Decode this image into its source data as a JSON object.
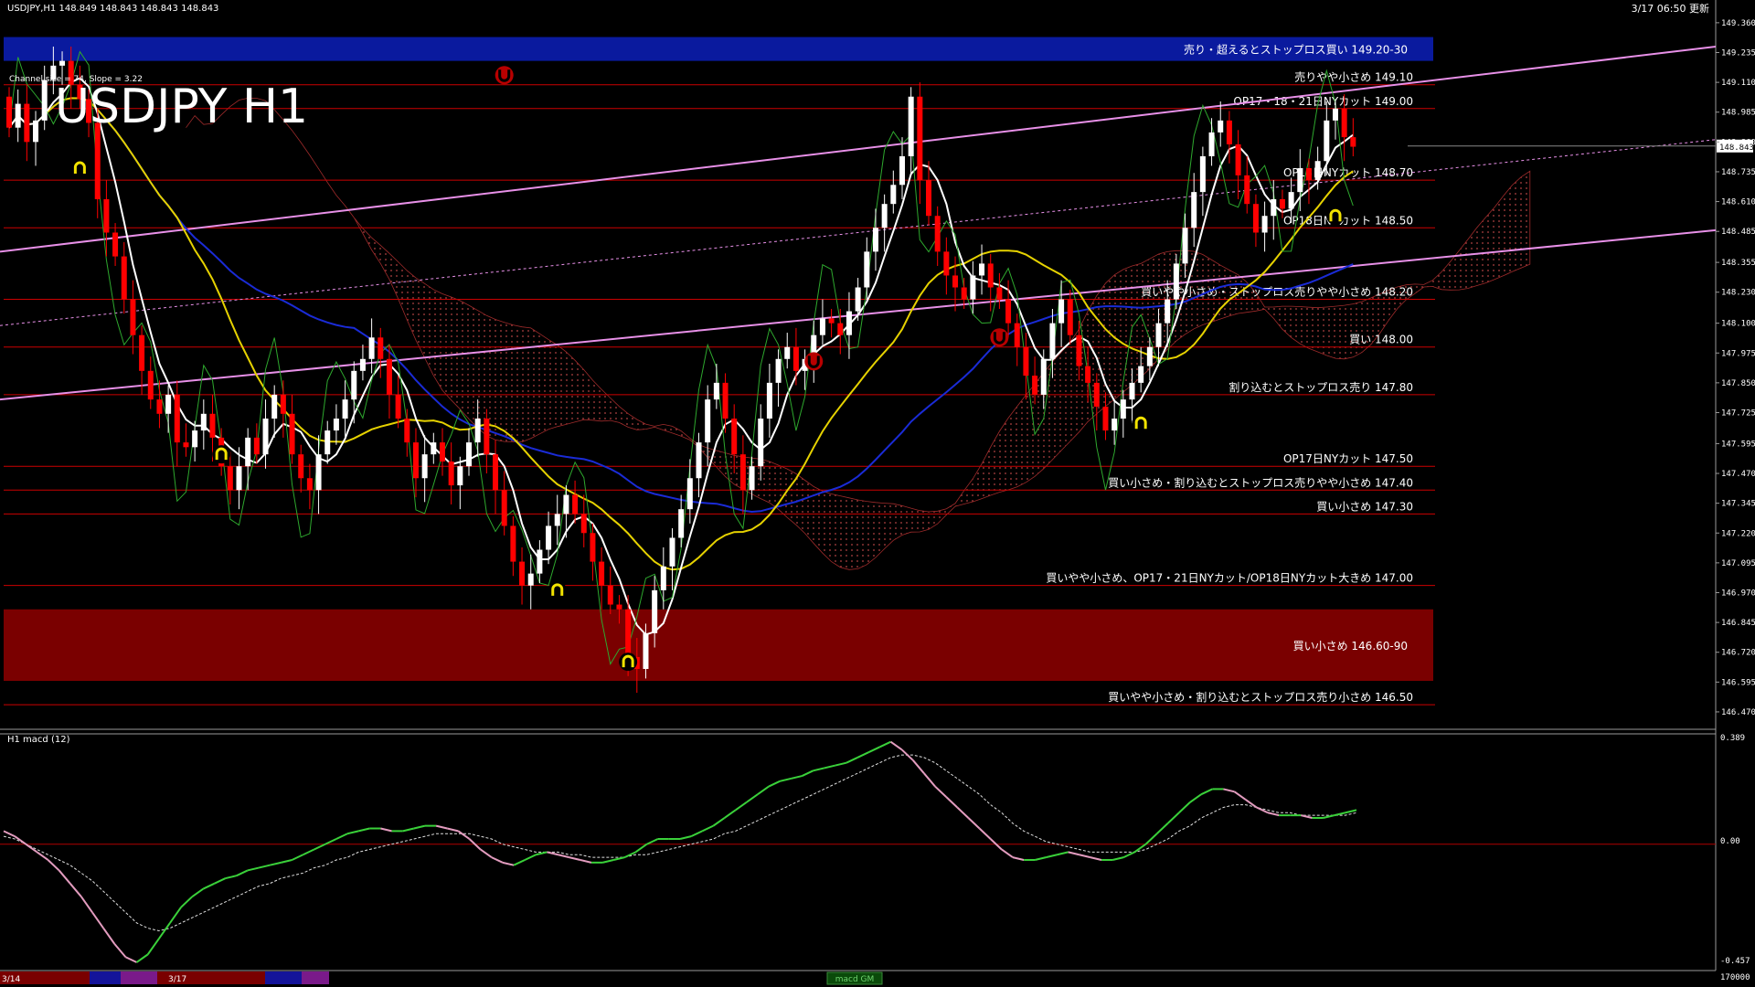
{
  "header": {
    "symbol_info": "USDJPY,H1  148.849 148.843 148.843 148.843",
    "channel_info": "Channel size = 74, Slope = 3.22",
    "big_title": "USDJPY H1",
    "update_text": "3/17 06:50 更新"
  },
  "macd_panel": {
    "title": "H1  macd (12)",
    "scale_labels": [
      "0.389",
      "0.00",
      "-0.457"
    ],
    "bottom_right_value": "170000",
    "scrollbar_label": "macd GM"
  },
  "time_axis": {
    "labels": [
      "3/14",
      "3/17"
    ]
  },
  "colors": {
    "background": "#000000",
    "bull_candle": "#ffffff",
    "bear_candle": "#ff0000",
    "level_line": "#cc0000",
    "sell_zone": "#0a1a9e",
    "buy_zone": "#7a0000",
    "ma_white": "#ffffff",
    "ma_yellow": "#e6d200",
    "ma_blue": "#1a2bd6",
    "chikou_green": "#2ea82e",
    "channel_pink": "#e890e8",
    "macd_up": "#3ad13a",
    "macd_down": "#e39cbf",
    "signal": "#e0e0e0"
  },
  "chart_data": {
    "type": "candlestick",
    "title": "USDJPY H1",
    "ylim": [
      146.42,
      149.44
    ],
    "price_ticks": [
      "149.360",
      "149.235",
      "149.110",
      "148.985",
      "148.860",
      "148.735",
      "148.610",
      "148.485",
      "148.355",
      "148.230",
      "148.100",
      "147.975",
      "147.850",
      "147.725",
      "147.595",
      "147.470",
      "147.345",
      "147.220",
      "147.095",
      "146.970",
      "146.845",
      "146.720",
      "146.595",
      "146.470"
    ],
    "current_price": "148.843",
    "zones": [
      {
        "label": "売り・超えるとストップロス買い 149.20-30",
        "from": 149.2,
        "to": 149.3,
        "kind": "sell"
      },
      {
        "label": "買い小さめ 146.60-90",
        "from": 146.6,
        "to": 146.9,
        "kind": "buy"
      }
    ],
    "levels": [
      {
        "price": 149.1,
        "label": "売りやや小さめ 149.10"
      },
      {
        "price": 149.0,
        "label": "OP17・18・21日NYカット 149.00"
      },
      {
        "price": 148.7,
        "label": "OP18日NYカット 148.70"
      },
      {
        "price": 148.5,
        "label": "OP18日NYカット 148.50"
      },
      {
        "price": 148.2,
        "label": "買いやや小さめ・ストップロス売りやや小さめ 148.20"
      },
      {
        "price": 148.0,
        "label": "買い 148.00"
      },
      {
        "price": 147.8,
        "label": "割り込むとストップロス売り 147.80"
      },
      {
        "price": 147.5,
        "label": "OP17日NYカット 147.50"
      },
      {
        "price": 147.4,
        "label": "買い小さめ・割り込むとストップロス売りやや小さめ 147.40"
      },
      {
        "price": 147.3,
        "label": "買い小さめ 147.30"
      },
      {
        "price": 147.0,
        "label": "買いやや小さめ、OP17・21日NYカット/OP18日NYカット大きめ 147.00"
      },
      {
        "price": 146.5,
        "label": "買いやや小さめ・割り込むとストップロス売り小さめ 146.50"
      }
    ],
    "candles": {
      "open": [
        149.05,
        148.92,
        149.02,
        148.86,
        148.95,
        149.12,
        149.18,
        149.2,
        149.1,
        149.04,
        148.94,
        148.62,
        148.48,
        148.38,
        148.2,
        148.05,
        147.9,
        147.78,
        147.72,
        147.8,
        147.6,
        147.58,
        147.65,
        147.72,
        147.62,
        147.5,
        147.4,
        147.5,
        147.62,
        147.55,
        147.7,
        147.8,
        147.72,
        147.55,
        147.45,
        147.4,
        147.55,
        147.65,
        147.7,
        147.78,
        147.9,
        147.95,
        148.04,
        147.95,
        147.8,
        147.7,
        147.6,
        147.45,
        147.55,
        147.6,
        147.52,
        147.42,
        147.5,
        147.6,
        147.7,
        147.55,
        147.4,
        147.25,
        147.1,
        147.0,
        147.05,
        147.15,
        147.25,
        147.3,
        147.38,
        147.3,
        147.22,
        147.1,
        147.0,
        146.92,
        146.9,
        146.7,
        146.65,
        146.8,
        146.98,
        147.08,
        147.2,
        147.32,
        147.45,
        147.6,
        147.78,
        147.85,
        147.7,
        147.55,
        147.4,
        147.5,
        147.7,
        147.85,
        147.95,
        148.0,
        147.9,
        147.95,
        148.05,
        148.12,
        148.1,
        148.05,
        148.15,
        148.25,
        148.4,
        148.5,
        148.6,
        148.68,
        148.8,
        149.05,
        148.7,
        148.55,
        148.4,
        148.3,
        148.25,
        148.2,
        148.3,
        148.35,
        148.25,
        148.2,
        148.1,
        148.0,
        147.88,
        147.8,
        147.95,
        148.1,
        148.2,
        148.05,
        147.92,
        147.85,
        147.75,
        147.65,
        147.7,
        147.78,
        147.85,
        147.92,
        148.0,
        148.1,
        148.2,
        148.35,
        148.5,
        148.65,
        148.8,
        148.9,
        148.95,
        148.85,
        148.72,
        148.6,
        148.48,
        148.55,
        148.62,
        148.58,
        148.65,
        148.75,
        148.7,
        148.78,
        148.95,
        149.0,
        148.88
      ],
      "close": [
        148.92,
        149.02,
        148.86,
        148.95,
        149.12,
        149.18,
        149.2,
        149.1,
        149.04,
        148.94,
        148.62,
        148.48,
        148.38,
        148.2,
        148.05,
        147.9,
        147.78,
        147.72,
        147.8,
        147.6,
        147.58,
        147.65,
        147.72,
        147.62,
        147.5,
        147.4,
        147.5,
        147.62,
        147.55,
        147.7,
        147.8,
        147.72,
        147.55,
        147.45,
        147.4,
        147.55,
        147.65,
        147.7,
        147.78,
        147.9,
        147.95,
        148.04,
        147.95,
        147.8,
        147.7,
        147.6,
        147.45,
        147.55,
        147.6,
        147.52,
        147.42,
        147.5,
        147.6,
        147.7,
        147.55,
        147.4,
        147.25,
        147.1,
        147.0,
        147.05,
        147.15,
        147.25,
        147.3,
        147.38,
        147.3,
        147.22,
        147.1,
        147.0,
        146.92,
        146.9,
        146.7,
        146.65,
        146.8,
        146.98,
        147.08,
        147.2,
        147.32,
        147.45,
        147.6,
        147.78,
        147.85,
        147.7,
        147.55,
        147.4,
        147.5,
        147.7,
        147.85,
        147.95,
        148.0,
        147.9,
        147.95,
        148.05,
        148.12,
        148.1,
        148.05,
        148.15,
        148.25,
        148.4,
        148.5,
        148.6,
        148.68,
        148.8,
        149.05,
        148.7,
        148.55,
        148.4,
        148.3,
        148.25,
        148.2,
        148.3,
        148.35,
        148.25,
        148.2,
        148.1,
        148.0,
        147.88,
        147.8,
        147.95,
        148.1,
        148.2,
        148.05,
        147.92,
        147.85,
        147.75,
        147.65,
        147.7,
        147.78,
        147.85,
        147.92,
        148.0,
        148.1,
        148.2,
        148.35,
        148.5,
        148.65,
        148.8,
        148.9,
        148.95,
        148.85,
        148.72,
        148.6,
        148.48,
        148.55,
        148.62,
        148.58,
        148.65,
        148.75,
        148.7,
        148.78,
        148.95,
        149.0,
        148.88,
        148.84
      ]
    },
    "macd": [
      0.05,
      0.03,
      0.0,
      -0.03,
      -0.06,
      -0.1,
      -0.15,
      -0.2,
      -0.26,
      -0.32,
      -0.38,
      -0.43,
      -0.45,
      -0.42,
      -0.36,
      -0.3,
      -0.24,
      -0.2,
      -0.17,
      -0.15,
      -0.13,
      -0.12,
      -0.1,
      -0.09,
      -0.08,
      -0.07,
      -0.06,
      -0.04,
      -0.02,
      0.0,
      0.02,
      0.04,
      0.05,
      0.06,
      0.06,
      0.05,
      0.05,
      0.06,
      0.07,
      0.07,
      0.06,
      0.05,
      0.02,
      -0.02,
      -0.05,
      -0.07,
      -0.08,
      -0.06,
      -0.04,
      -0.03,
      -0.04,
      -0.05,
      -0.06,
      -0.07,
      -0.07,
      -0.06,
      -0.05,
      -0.03,
      0.0,
      0.02,
      0.02,
      0.02,
      0.03,
      0.05,
      0.07,
      0.1,
      0.13,
      0.16,
      0.19,
      0.22,
      0.24,
      0.25,
      0.26,
      0.28,
      0.29,
      0.3,
      0.31,
      0.33,
      0.35,
      0.37,
      0.39,
      0.36,
      0.32,
      0.27,
      0.22,
      0.18,
      0.14,
      0.1,
      0.06,
      0.02,
      -0.02,
      -0.05,
      -0.06,
      -0.06,
      -0.05,
      -0.04,
      -0.03,
      -0.04,
      -0.05,
      -0.06,
      -0.06,
      -0.05,
      -0.03,
      0.0,
      0.04,
      0.08,
      0.12,
      0.16,
      0.19,
      0.21,
      0.21,
      0.2,
      0.17,
      0.14,
      0.12,
      0.11,
      0.11,
      0.11,
      0.1,
      0.1,
      0.11,
      0.12,
      0.13
    ],
    "macd_signal": [
      0.03,
      0.02,
      0.0,
      -0.02,
      -0.04,
      -0.06,
      -0.08,
      -0.11,
      -0.14,
      -0.18,
      -0.22,
      -0.26,
      -0.3,
      -0.32,
      -0.33,
      -0.32,
      -0.3,
      -0.28,
      -0.26,
      -0.24,
      -0.22,
      -0.2,
      -0.18,
      -0.16,
      -0.15,
      -0.13,
      -0.12,
      -0.11,
      -0.09,
      -0.08,
      -0.06,
      -0.05,
      -0.03,
      -0.02,
      -0.01,
      0.0,
      0.01,
      0.02,
      0.03,
      0.04,
      0.04,
      0.04,
      0.04,
      0.03,
      0.02,
      0.0,
      -0.01,
      -0.02,
      -0.03,
      -0.03,
      -0.03,
      -0.04,
      -0.04,
      -0.05,
      -0.05,
      -0.05,
      -0.05,
      -0.04,
      -0.04,
      -0.03,
      -0.02,
      -0.01,
      0.0,
      0.01,
      0.02,
      0.04,
      0.05,
      0.07,
      0.09,
      0.11,
      0.13,
      0.15,
      0.17,
      0.19,
      0.21,
      0.23,
      0.25,
      0.27,
      0.29,
      0.31,
      0.33,
      0.34,
      0.34,
      0.33,
      0.31,
      0.28,
      0.25,
      0.22,
      0.19,
      0.15,
      0.12,
      0.08,
      0.05,
      0.03,
      0.01,
      0.0,
      -0.01,
      -0.02,
      -0.03,
      -0.03,
      -0.03,
      -0.03,
      -0.03,
      -0.02,
      0.0,
      0.02,
      0.05,
      0.07,
      0.1,
      0.12,
      0.14,
      0.15,
      0.15,
      0.14,
      0.13,
      0.12,
      0.12,
      0.11,
      0.11,
      0.11,
      0.11,
      0.11,
      0.12
    ]
  }
}
